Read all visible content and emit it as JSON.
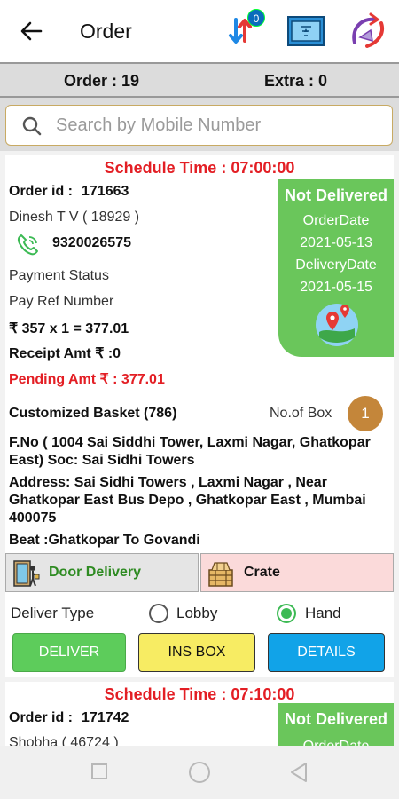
{
  "header": {
    "title": "Order",
    "sort_badge": "0"
  },
  "summary": {
    "order_count": "Order : 19",
    "extra_count": "Extra : 0"
  },
  "search": {
    "placeholder": "Search by Mobile Number"
  },
  "orders": [
    {
      "schedule": "Schedule Time : 07:00:00",
      "order_id_label": "Order id :",
      "order_id": "171663",
      "customer": "Dinesh T V  ( 18929 )",
      "phone": "9320026575",
      "payment_status": "Payment Status",
      "pay_ref": "Pay Ref Number",
      "amount": "₹ 357 x 1 = 377.01",
      "receipt": "Receipt Amt ₹ :0",
      "pending": "Pending Amt ₹ : 377.01",
      "status": "Not Delivered",
      "order_date_label": "OrderDate",
      "order_date": "2021-05-13",
      "delivery_date_label": "DeliveryDate",
      "delivery_date": "2021-05-15",
      "basket": "Customized Basket (786)",
      "no_of_box_label": "No.of Box",
      "no_of_box": "1",
      "flat": "F.No ( 1004 Sai Siddhi Tower, Laxmi Nagar, Ghatkopar East) Soc: Sai Sidhi Towers",
      "address": "Address: Sai Sidhi Towers , Laxmi Nagar , Near Ghatkopar East Bus Depo , Ghatkopar East , Mumbai 400075",
      "beat": "Beat :Ghatkopar To Govandi",
      "tab_door": "Door Delivery",
      "tab_crate": "Crate",
      "deliver_type_label": "Deliver Type",
      "option_lobby": "Lobby",
      "option_hand": "Hand",
      "btn_deliver": "DELIVER",
      "btn_ins_box": "INS BOX",
      "btn_details": "DETAILS"
    },
    {
      "schedule": "Schedule Time : 07:10:00",
      "order_id_label": "Order id :",
      "order_id": "171742",
      "customer": "Shobha  ( 46724 )",
      "status": "Not Delivered",
      "order_date_label": "OrderDate"
    }
  ],
  "colors": {
    "status_green": "#6ac65b",
    "schedule_red": "#e31e24",
    "deliver_btn": "#5dcc5b",
    "ins_box_btn": "#f7ec63",
    "details_btn": "#11a3e8"
  }
}
